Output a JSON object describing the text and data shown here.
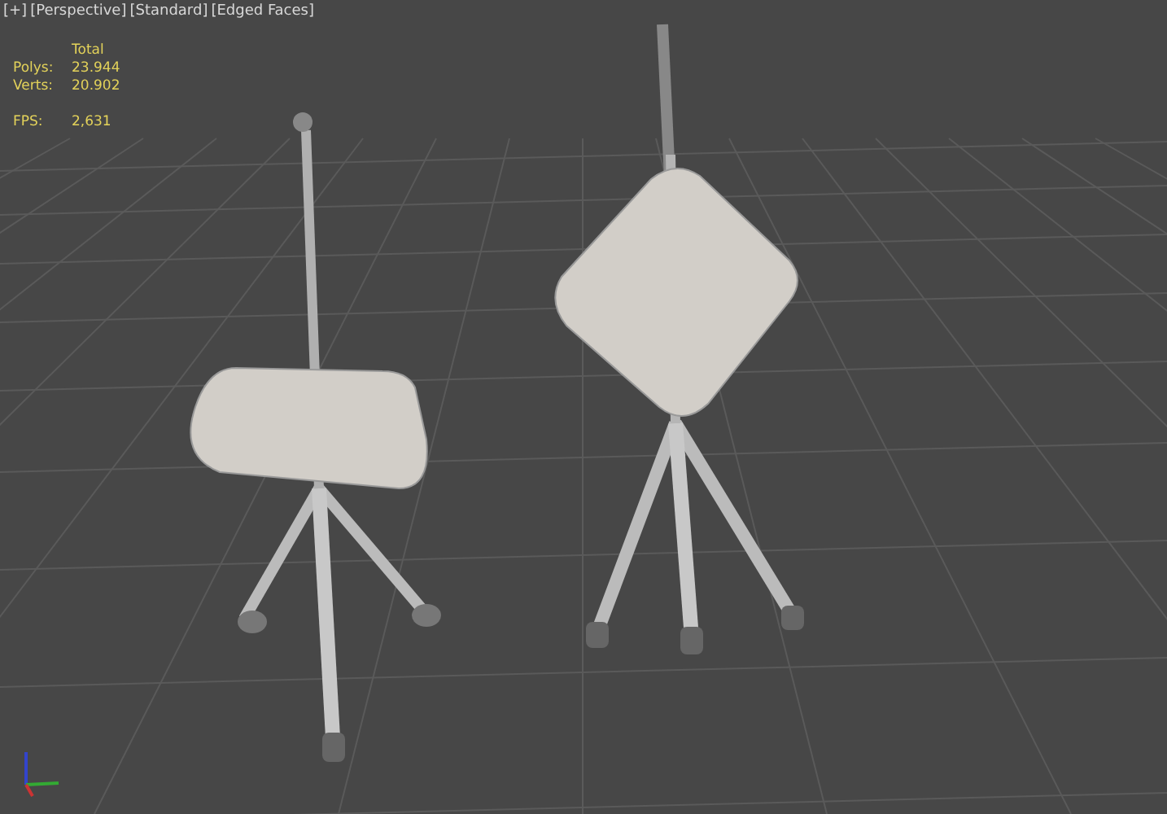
{
  "viewport_labels": [
    "[+]",
    "[Perspective]",
    "[Standard]",
    "[Edged Faces]"
  ],
  "statistics": {
    "header": "Total",
    "rows": [
      {
        "label": "Polys:",
        "value": "23.944"
      },
      {
        "label": "Verts:",
        "value": "20.902"
      }
    ],
    "fps": {
      "label": "FPS:",
      "value": "2,631"
    }
  }
}
